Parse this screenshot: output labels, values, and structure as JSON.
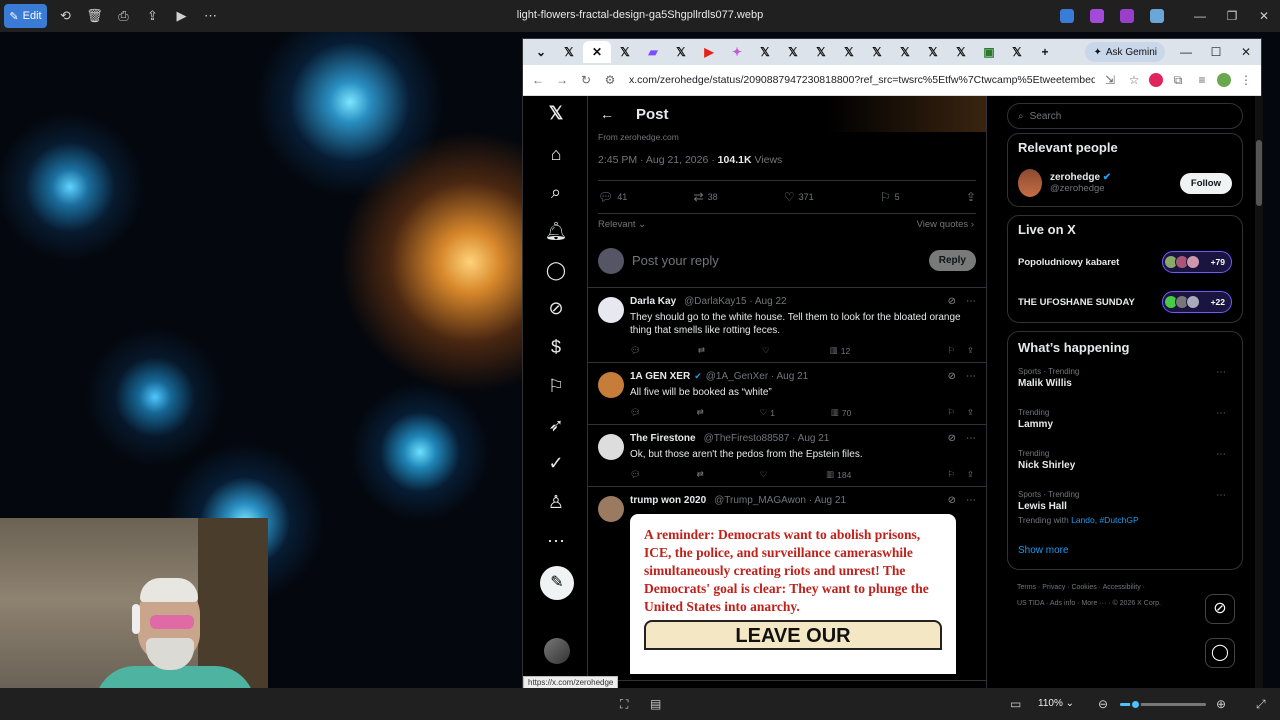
{
  "viewer": {
    "edit_label": "Edit",
    "title": "light-flowers-fractal-design-ga5Shgpllrdls077.webp",
    "zoom": "110%",
    "zoom_fraction": 0.18
  },
  "browser": {
    "gemini_label": "Ask Gemini",
    "url": "x.com/zerohedge/status/2090887947230818800?ref_src=twsrc%5Etfw%7Ctwcamp%5Etweetembed%7Ct...",
    "status_url": "https://x.com/zerohedge",
    "tab_icons": [
      "x-icon",
      "x-icon",
      "x-icon",
      "x-icon",
      "x-icon",
      "youtube-icon",
      "gemini-icon",
      "x-icon",
      "x-icon",
      "x-icon",
      "x-icon",
      "x-icon",
      "x-icon",
      "x-icon",
      "x-icon",
      "x-icon",
      "x-icon"
    ]
  },
  "post": {
    "header_title": "Post",
    "from": "From zerohedge.com",
    "time": "2:45 PM · Aug 21, 2026 ·",
    "views_count": "104.1K",
    "views_label": "Views",
    "replies": "41",
    "reposts": "38",
    "likes": "371",
    "bookmarks": "5",
    "sort_label": "Relevant",
    "view_quotes": "View quotes",
    "reply_placeholder": "Post your reply",
    "reply_button": "Reply"
  },
  "replies": [
    {
      "name": "Darla Kay",
      "handle": "@DarlaKay15 · Aug 22",
      "verified": "",
      "text": "They should go to the white house. Tell them to look for the bloated orange thing that smells like rotting feces.",
      "likes": "",
      "views": "12",
      "avatar_color": "#e8e8f0"
    },
    {
      "name": "1A GEN XER",
      "handle": "@1A_GenXer · Aug 21",
      "verified": "✔",
      "text": "All five will be booked as “white”",
      "likes": "1",
      "views": "70",
      "avatar_color": "#c77d3a"
    },
    {
      "name": "The Firestone",
      "handle": "@TheFiresto88587 · Aug 21",
      "verified": "",
      "text": "Ok, but those aren't the pedos from the Epstein files.",
      "likes": "",
      "views": "184",
      "avatar_color": "#dddddd"
    },
    {
      "name": "trump won 2020",
      "handle": "@Trump_MAGAwon · Aug 21",
      "verified": "",
      "text": "",
      "likes": "",
      "views": "",
      "avatar_color": "#9a7a60"
    }
  ],
  "meme": {
    "text": "A reminder: Democrats want to abolish prisons, ICE, the police, and surveillance cameraswhile simultaneously creating riots and unrest! The Democrats' goal is clear: They want to plunge the United States into anarchy.",
    "sign": "LEAVE OUR"
  },
  "sidebar": {
    "search_placeholder": "Search",
    "relevant_title": "Relevant people",
    "person_name": "zerohedge",
    "person_handle": "@zerohedge",
    "follow_label": "Follow",
    "live_title": "Live on X",
    "live": [
      {
        "title": "Popoludniowy kabaret",
        "count": "+79"
      },
      {
        "title": "THE UFOSHANE SUNDAY",
        "count": "+22"
      }
    ],
    "happening_title": "What’s happening",
    "trends": [
      {
        "context": "Sports · Trending",
        "name": "Malik Willis",
        "with": "",
        "with_links": ""
      },
      {
        "context": "Trending",
        "name": "Lammy",
        "with": "",
        "with_links": ""
      },
      {
        "context": "Trending",
        "name": "Nick Shirley",
        "with": "",
        "with_links": ""
      },
      {
        "context": "Sports · Trending",
        "name": "Lewis Hall",
        "with": "Trending with",
        "with_links": "Lando, #DutchGP"
      }
    ],
    "show_more": "Show more",
    "footer_1": "Terms ·  Privacy ·  Cookies ·  Accessibility ·",
    "footer_2": "US TIDA ·  Ads info ·  More ··· ·  © 2026 X Corp."
  }
}
